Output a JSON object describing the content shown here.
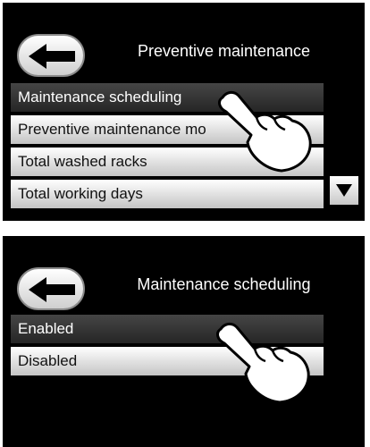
{
  "screen1": {
    "title": "Preventive maintenance",
    "items": [
      {
        "label": "Maintenance scheduling",
        "selected": true
      },
      {
        "label": "Preventive maintenance mo",
        "selected": false
      },
      {
        "label": "Total washed racks",
        "selected": false
      },
      {
        "label": "Total working days",
        "selected": false
      }
    ]
  },
  "screen2": {
    "title": "Maintenance scheduling",
    "items": [
      {
        "label": "Enabled",
        "selected": true
      },
      {
        "label": "Disabled",
        "selected": false
      }
    ]
  },
  "icons": {
    "back": "left-arrow-icon",
    "scroll": "down-triangle-icon",
    "pointer": "pointing-hand-icon"
  },
  "colors": {
    "screen_bg": "#000000",
    "selected_row": "#333333",
    "normal_row": "#e8e8e8"
  }
}
